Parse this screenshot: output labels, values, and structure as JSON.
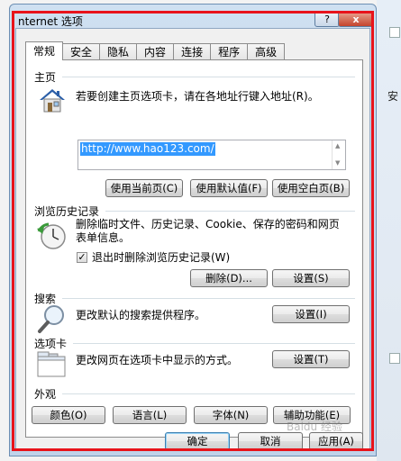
{
  "window": {
    "title": "nternet 选项",
    "help_label": "?",
    "close_label": "x"
  },
  "tabs": [
    {
      "label": "常规",
      "active": true
    },
    {
      "label": "安全"
    },
    {
      "label": "隐私"
    },
    {
      "label": "内容"
    },
    {
      "label": "连接"
    },
    {
      "label": "程序"
    },
    {
      "label": "高级"
    }
  ],
  "home": {
    "title": "主页",
    "desc": "若要创建主页选项卡，请在各地址行键入地址(R)。",
    "url": "http://www.hao123.com/",
    "btn_current": "使用当前页(C)",
    "btn_default": "使用默认值(F)",
    "btn_blank": "使用空白页(B)"
  },
  "history": {
    "title": "浏览历史记录",
    "desc_line1": "删除临时文件、历史记录、Cookie、保存的密码和网页",
    "desc_line2": "表单信息。",
    "checkbox_label": "退出时删除浏览历史记录(W)",
    "checkbox_checked": "✓",
    "btn_delete": "删除(D)...",
    "btn_settings": "设置(S)"
  },
  "search": {
    "title": "搜索",
    "desc": "更改默认的搜索提供程序。",
    "btn_settings": "设置(I)"
  },
  "tabs_section": {
    "title": "选项卡",
    "desc": "更改网页在选项卡中显示的方式。",
    "btn_settings": "设置(T)"
  },
  "appearance": {
    "title": "外观",
    "btn_colors": "颜色(O)",
    "btn_languages": "语言(L)",
    "btn_fonts": "字体(N)",
    "btn_accessibility": "辅助功能(E)"
  },
  "footer": {
    "ok": "确定",
    "cancel": "取消",
    "apply": "应用(A)"
  },
  "background": {
    "fragment": "安"
  },
  "watermark": "Baidu 经验",
  "icons": [
    "house-icon",
    "clock-history-icon",
    "magnifier-icon",
    "tab-window-icon"
  ]
}
